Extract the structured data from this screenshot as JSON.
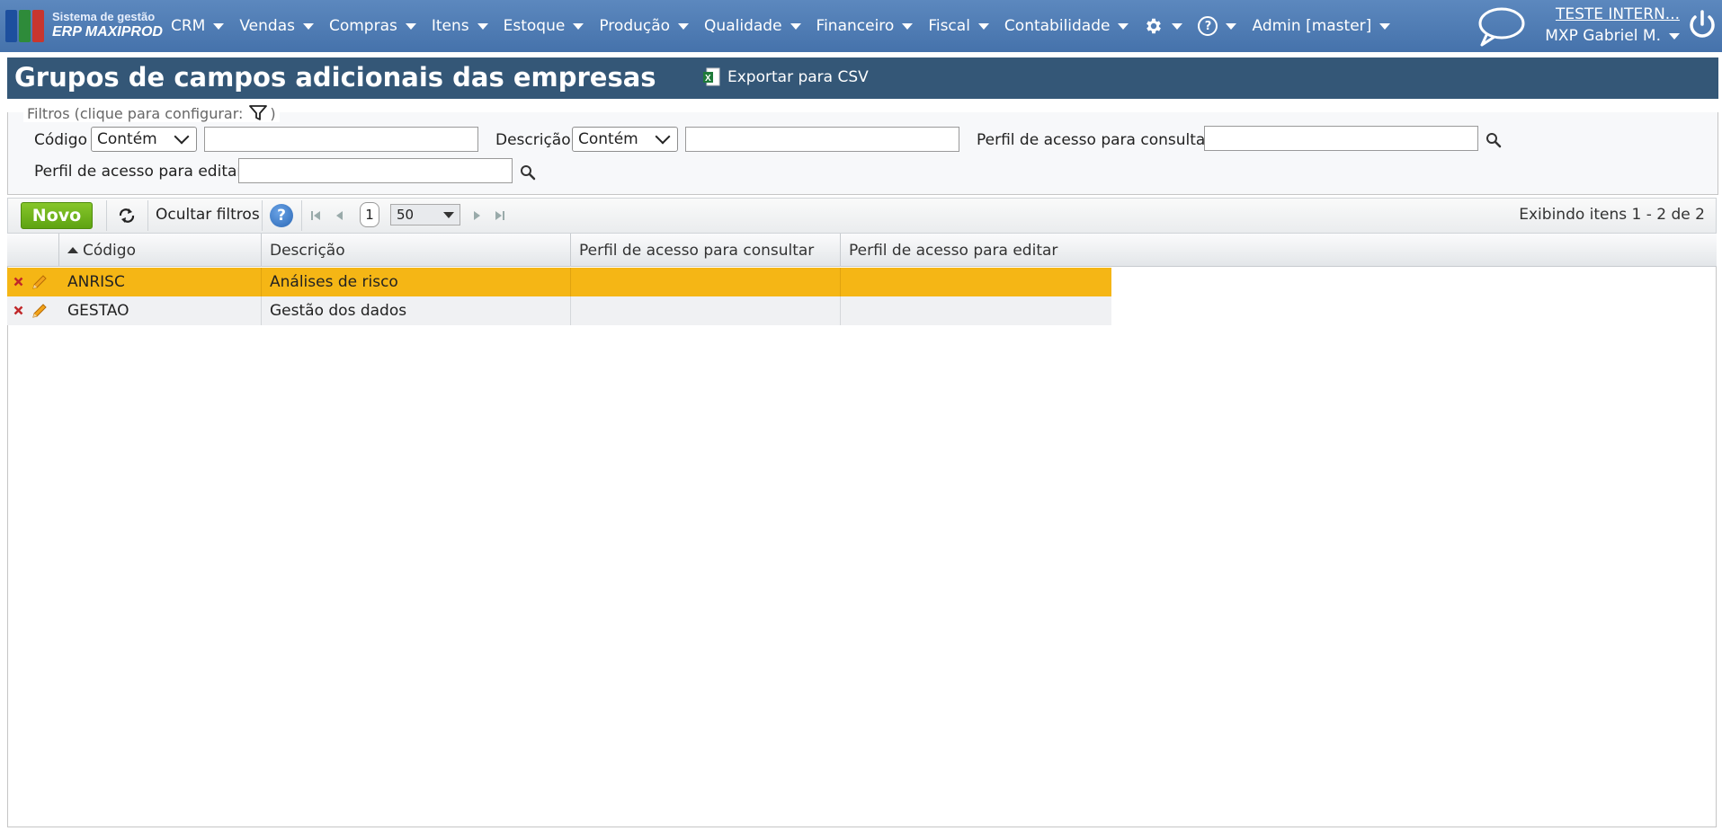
{
  "app": {
    "logo_line1": "Sistema de gestão",
    "logo_line2": "ERP MAXIPROD"
  },
  "nav": {
    "items": [
      {
        "label": "CRM"
      },
      {
        "label": "Vendas"
      },
      {
        "label": "Compras"
      },
      {
        "label": "Itens"
      },
      {
        "label": "Estoque"
      },
      {
        "label": "Produção"
      },
      {
        "label": "Qualidade"
      },
      {
        "label": "Financeiro"
      },
      {
        "label": "Fiscal"
      },
      {
        "label": "Contabilidade"
      }
    ],
    "admin_label": "Admin [master]",
    "company_link": "TESTE INTERN...",
    "user_name": "MXP Gabriel M."
  },
  "page": {
    "title": "Grupos de campos adicionais das empresas",
    "export_label": "Exportar para CSV"
  },
  "filters": {
    "legend": "Filtros (clique para configurar:",
    "legend_close": ")",
    "codigo_label": "Código",
    "codigo_mode": "Contém",
    "codigo_value": "",
    "descricao_label": "Descrição",
    "descricao_mode": "Contém",
    "descricao_value": "",
    "perfil_consultar_label": "Perfil de acesso para consultar",
    "perfil_consultar_value": "",
    "perfil_editar_label": "Perfil de acesso para editar",
    "perfil_editar_value": ""
  },
  "toolbar": {
    "new_label": "Novo",
    "hide_filters_label": "Ocultar filtros",
    "help_label": "?",
    "current_page": "1",
    "page_size": "50",
    "showing": "Exibindo itens 1 - 2 de 2"
  },
  "grid": {
    "columns": [
      "Código",
      "Descrição",
      "Perfil de acesso para consultar",
      "Perfil de acesso para editar"
    ],
    "rows": [
      {
        "codigo": "ANRISC",
        "descricao": "Análises de risco",
        "perfil_consultar": "",
        "perfil_editar": ""
      },
      {
        "codigo": "GESTAO",
        "descricao": "Gestão dos dados",
        "perfil_consultar": "",
        "perfil_editar": ""
      }
    ]
  },
  "colors": {
    "nav_bg": "#4a77b0",
    "title_bg": "#345777",
    "selected_row": "#f5b615",
    "alt_row": "#f0f1f3",
    "new_button": "#6db11a"
  }
}
